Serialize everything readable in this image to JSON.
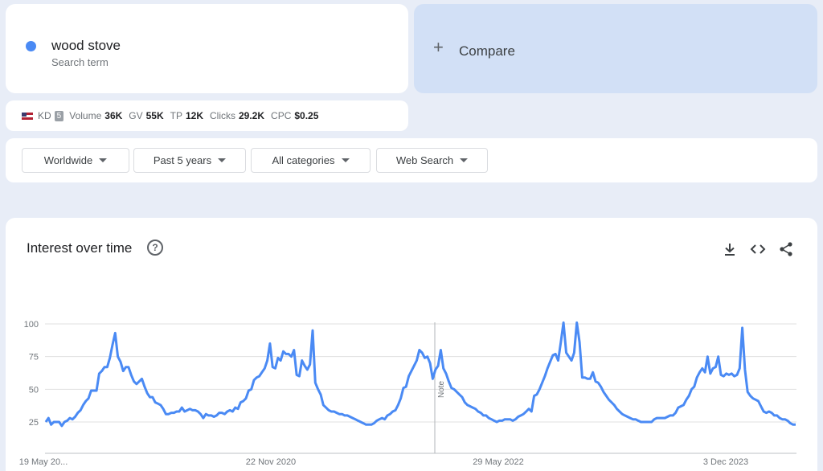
{
  "search_term": {
    "name": "wood stove",
    "subtitle": "Search term",
    "color": "#4a8af4"
  },
  "compare": {
    "icon": "plus-icon",
    "label": "Compare"
  },
  "keyword_metrics": {
    "kd_label": "KD",
    "kd_value": "5",
    "volume_label": "Volume",
    "volume_value": "36K",
    "gv_label": "GV",
    "gv_value": "55K",
    "tp_label": "TP",
    "tp_value": "12K",
    "clicks_label": "Clicks",
    "clicks_value": "29.2K",
    "cpc_label": "CPC",
    "cpc_value": "$0.25"
  },
  "filters": {
    "region": "Worldwide",
    "period": "Past 5 years",
    "category": "All categories",
    "search_type": "Web Search"
  },
  "chart_section": {
    "title": "Interest over time",
    "icons": [
      "help-icon",
      "download-icon",
      "embed-icon",
      "share-icon"
    ]
  },
  "chart_data": {
    "type": "line",
    "ylim": [
      0,
      100
    ],
    "y_ticks": [
      "100",
      "75",
      "50",
      "25"
    ],
    "x_tick_labels": [
      "19 May 20...",
      "22 Nov 2020",
      "29 May 2022",
      "3 Dec 2023"
    ],
    "annotation": "Note",
    "series": [
      {
        "color": "#4a8af4",
        "values": [
          25,
          28,
          23,
          25,
          25,
          25,
          22,
          25,
          26,
          28,
          27,
          29,
          32,
          34,
          38,
          41,
          43,
          49,
          49,
          49,
          62,
          64,
          67,
          67,
          74,
          84,
          93,
          75,
          71,
          64,
          67,
          67,
          61,
          56,
          54,
          56,
          58,
          52,
          47,
          44,
          44,
          40,
          39,
          38,
          35,
          31,
          31,
          32,
          32,
          33,
          33,
          36,
          33,
          34,
          35,
          34,
          34,
          33,
          31,
          28,
          31,
          30,
          30,
          29,
          30,
          32,
          32,
          31,
          33,
          34,
          33,
          36,
          35,
          40,
          41,
          43,
          49,
          50,
          57,
          59,
          60,
          63,
          66,
          72,
          85,
          67,
          66,
          74,
          72,
          79,
          77,
          77,
          75,
          80,
          61,
          60,
          72,
          68,
          65,
          69,
          95,
          55,
          50,
          46,
          38,
          36,
          34,
          33,
          33,
          32,
          31,
          31,
          30,
          30,
          29,
          28,
          27,
          26,
          25,
          24,
          23,
          23,
          23,
          24,
          26,
          27,
          28,
          27,
          30,
          31,
          33,
          34,
          38,
          43,
          51,
          52,
          60,
          64,
          68,
          72,
          80,
          78,
          74,
          75,
          70,
          58,
          65,
          68,
          80,
          66,
          62,
          56,
          51,
          50,
          48,
          46,
          44,
          40,
          38,
          37,
          36,
          35,
          33,
          32,
          30,
          30,
          28,
          27,
          26,
          25,
          26,
          26,
          27,
          27,
          27,
          26,
          27,
          29,
          30,
          31,
          33,
          35,
          33,
          45,
          46,
          50,
          55,
          60,
          66,
          71,
          76,
          77,
          72,
          86,
          101,
          78,
          75,
          72,
          78,
          101,
          86,
          59,
          59,
          58,
          58,
          63,
          56,
          55,
          52,
          48,
          45,
          42,
          40,
          38,
          35,
          33,
          31,
          30,
          29,
          28,
          27,
          27,
          26,
          25,
          25,
          25,
          25,
          25,
          27,
          28,
          28,
          28,
          28,
          29,
          30,
          30,
          32,
          36,
          37,
          38,
          42,
          45,
          50,
          52,
          59,
          63,
          66,
          63,
          75,
          62,
          66,
          67,
          75,
          61,
          60,
          62,
          61,
          62,
          60,
          61,
          66,
          97,
          65,
          48,
          45,
          43,
          42,
          41,
          37,
          33,
          32,
          33,
          32,
          30,
          30,
          28,
          27,
          27,
          26,
          24,
          23,
          23
        ]
      }
    ]
  }
}
